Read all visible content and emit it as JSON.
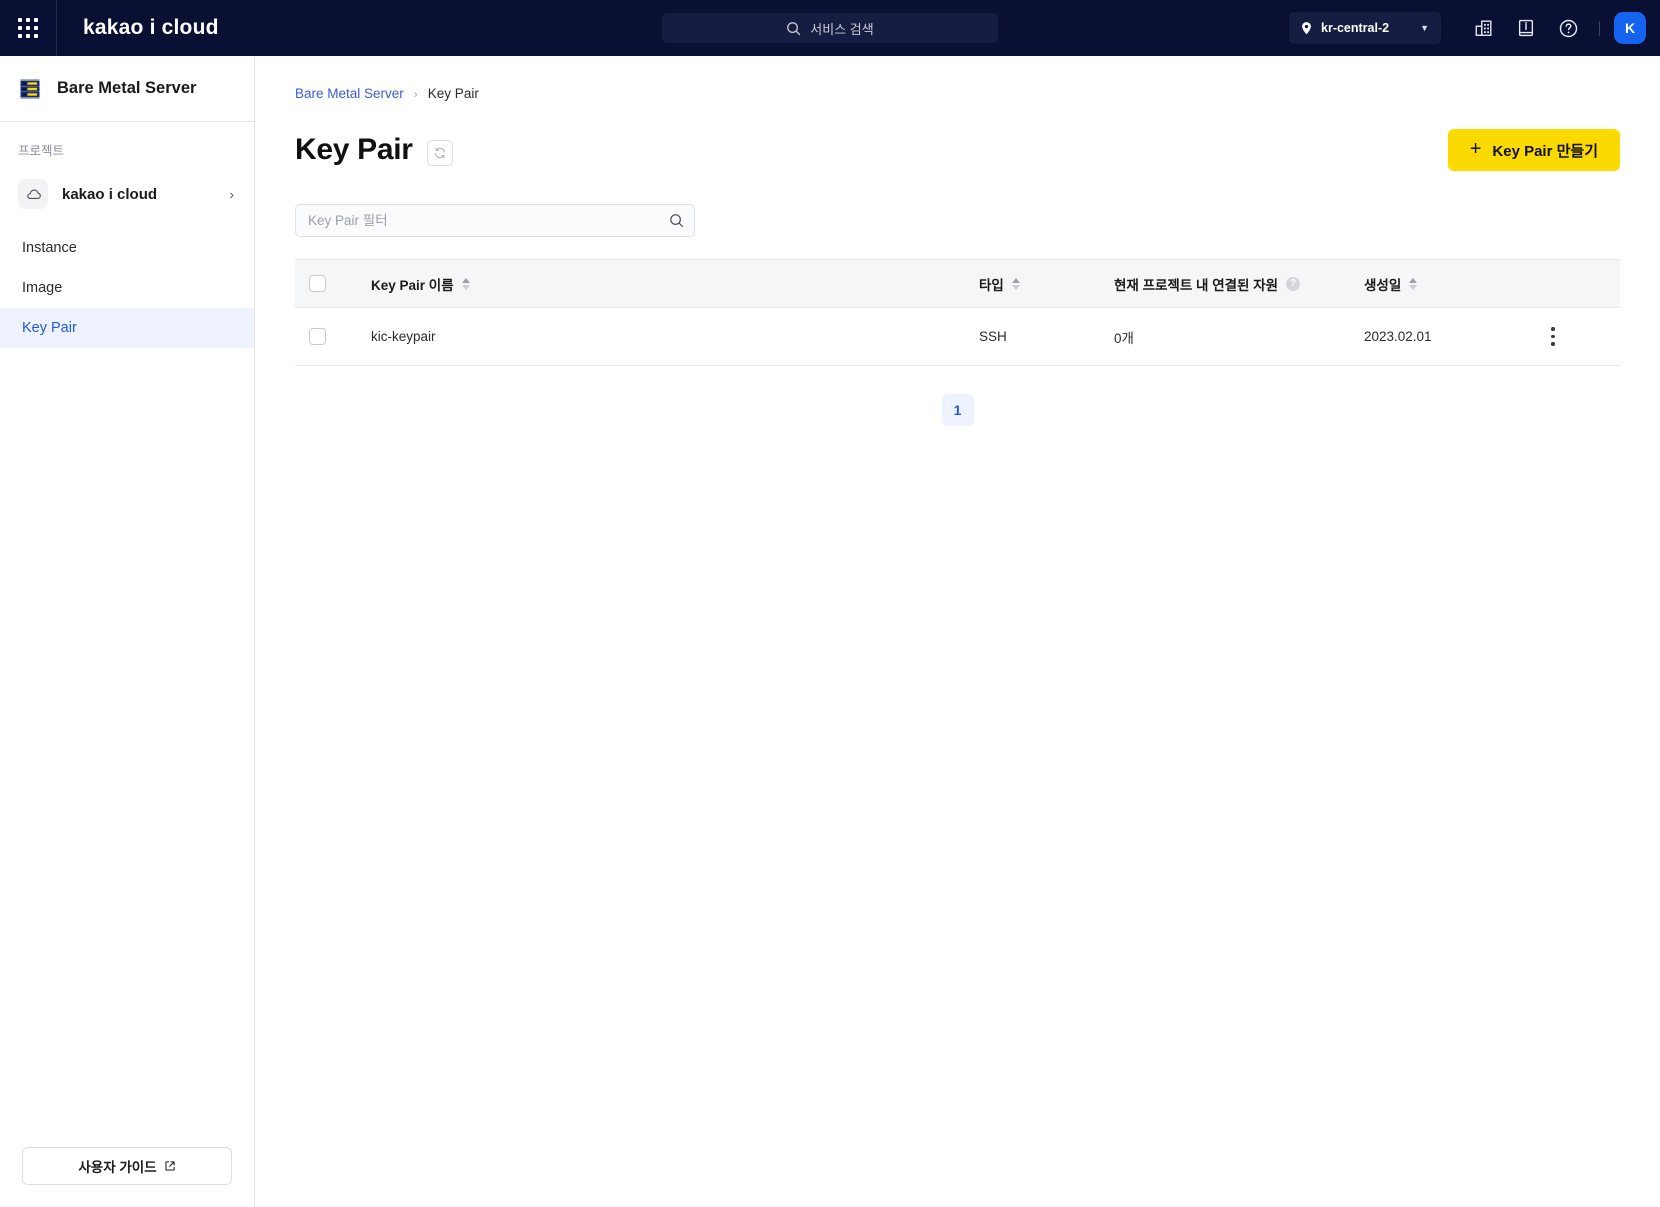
{
  "header": {
    "brand": "kakao i cloud",
    "app_grid_icon": "grid-apps-icon",
    "search": {
      "placeholder": "서비스 검색",
      "icon": "search-icon"
    },
    "region": {
      "label": "kr-central-2",
      "pin_icon": "location-pin-icon",
      "caret_icon": "chevron-down-icon"
    },
    "icons": [
      {
        "name": "organization-building-icon"
      },
      {
        "name": "manual-book-icon"
      },
      {
        "name": "help-circle-icon"
      }
    ],
    "avatar": {
      "initial": "K",
      "color": "#1464f0"
    },
    "background": "#0a1033"
  },
  "sidebar": {
    "service_title": "Bare Metal Server",
    "service_icon": "server-rack-icon",
    "project_label": "프로젝트",
    "project": {
      "name": "kakao i cloud",
      "icon": "cloud-icon",
      "chevron": "chevron-right-icon"
    },
    "items": [
      {
        "label": "Instance",
        "active": false
      },
      {
        "label": "Image",
        "active": false
      },
      {
        "label": "Key Pair",
        "active": true
      }
    ],
    "guide_button": {
      "label": "사용자 가이드",
      "icon": "external-link-icon"
    },
    "active_color": "#1f5bd7"
  },
  "breadcrumb": {
    "root": "Bare Metal Server",
    "separator": "›",
    "current": "Key Pair"
  },
  "page": {
    "title": "Key Pair",
    "refresh_icon": "refresh-icon",
    "create_button": {
      "label": "Key Pair 만들기",
      "icon": "plus-icon",
      "color": "#fada00"
    }
  },
  "filter": {
    "placeholder": "Key Pair 필터",
    "value": "",
    "icon": "search-icon"
  },
  "table": {
    "columns": [
      {
        "key": "checkbox",
        "label": "",
        "sortable": false
      },
      {
        "key": "name",
        "label": "Key Pair 이름",
        "sortable": true
      },
      {
        "key": "type",
        "label": "타입",
        "sortable": true
      },
      {
        "key": "resources",
        "label": "현재 프로젝트 내 연결된 자원",
        "sortable": false,
        "help": true
      },
      {
        "key": "created",
        "label": "생성일",
        "sortable": true
      },
      {
        "key": "menu",
        "label": "",
        "sortable": false
      }
    ],
    "rows": [
      {
        "name": "kic-keypair",
        "type": "SSH",
        "resources": "0개",
        "created": "2023.02.01",
        "menu_icon": "kebab-menu-icon"
      }
    ]
  },
  "pagination": {
    "pages": [
      "1"
    ],
    "current": "1"
  }
}
